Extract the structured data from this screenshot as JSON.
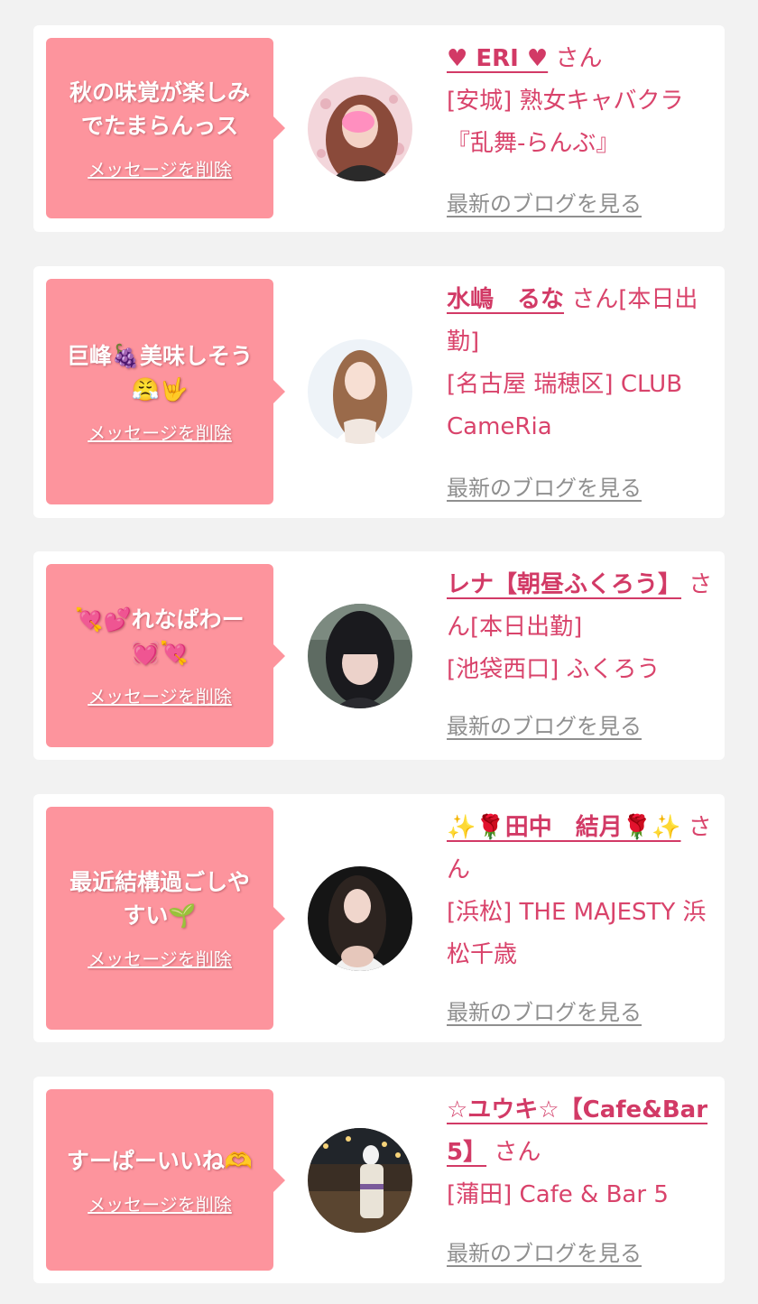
{
  "cards": [
    {
      "message": "秋の味覚が楽しみ\nでたまらんっス",
      "delete_label": "メッセージを削除",
      "name": "♥ ERI ♥",
      "suffix": "さん",
      "shop": "[安城] 熟女キャバクラ『乱舞-らんぶ』",
      "blog_label": "最新のブログを見る",
      "avatar_icon": "woman-portrait-pink-icon"
    },
    {
      "message": "巨峰🍇美味しそう\n😤🤟",
      "delete_label": "メッセージを削除",
      "name": "水嶋　るな",
      "suffix": "さん[本日出勤]",
      "shop": "[名古屋 瑞穂区] CLUB CameRia",
      "blog_label": "最新のブログを見る",
      "avatar_icon": "woman-portrait-light-icon"
    },
    {
      "message": "💘💕れなぱわー\n💓💘",
      "delete_label": "メッセージを削除",
      "name": "レナ【朝昼ふくろう】",
      "suffix": "さん[本日出勤]",
      "shop": "[池袋西口] ふくろう",
      "blog_label": "最新のブログを見る",
      "avatar_icon": "woman-portrait-dark-icon"
    },
    {
      "message": "最近結構過ごしや\nすい🌱",
      "delete_label": "メッセージを削除",
      "name": "✨🌹田中　結月🌹✨",
      "suffix": "さん",
      "shop": "[浜松] THE MAJESTY 浜松千歳",
      "blog_label": "最新のブログを見る",
      "avatar_icon": "woman-portrait-black-icon"
    },
    {
      "message": "すーぱーいいね🫶",
      "delete_label": "メッセージを削除",
      "name": "☆ユウキ☆【Cafe&Bar 5】",
      "suffix": "さん",
      "shop": "[蒲田] Cafe & Bar 5",
      "blog_label": "最新のブログを見る",
      "avatar_icon": "woman-kimono-night-icon"
    }
  ],
  "colors": {
    "background": "#f2f2f2",
    "bubble": "#fd949d",
    "name": "#d23a66",
    "text": "#d9436b",
    "link_gray": "#8f8f8f"
  }
}
